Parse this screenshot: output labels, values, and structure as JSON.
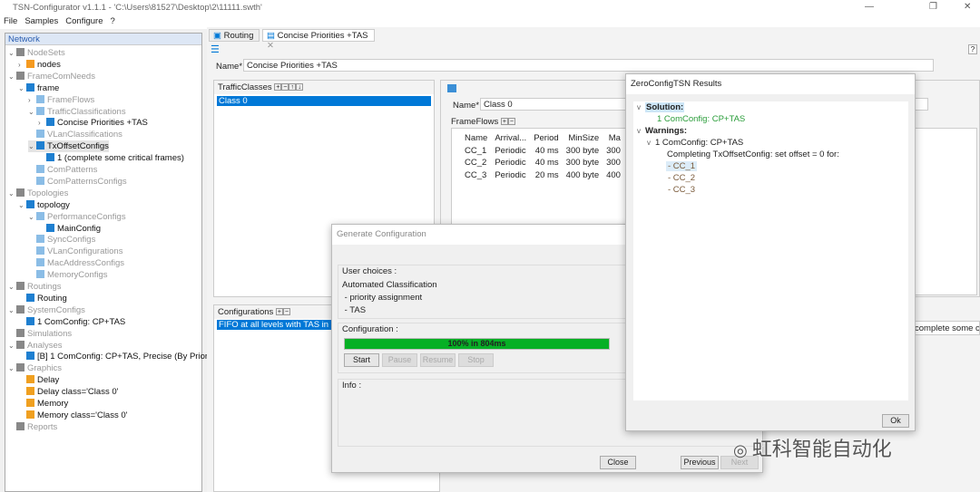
{
  "window": {
    "title": "TSN-Configurator v1.1.1 - 'C:\\Users\\81527\\Desktop\\2\\11111.swth'",
    "min": "—",
    "max": "❐",
    "close": "✕"
  },
  "menu": [
    "File",
    "Samples",
    "Configure",
    "?"
  ],
  "tree": {
    "header": "Network",
    "items": [
      {
        "label": "NodeSets",
        "arrow": "v",
        "level": 0,
        "style": "gray"
      },
      {
        "label": "nodes",
        "arrow": ">",
        "level": 1,
        "style": "dark"
      },
      {
        "label": "FrameComNeeds",
        "arrow": "v",
        "level": 0,
        "style": "gray"
      },
      {
        "label": "frame",
        "arrow": "v",
        "level": 1,
        "style": "dark"
      },
      {
        "label": "FrameFlows",
        "arrow": ">",
        "level": 2,
        "style": "gray"
      },
      {
        "label": "TrafficClassifications",
        "arrow": "v",
        "level": 2,
        "style": "gray"
      },
      {
        "label": "Concise Priorities +TAS",
        "arrow": ">",
        "level": 3,
        "style": "dark"
      },
      {
        "label": "VLanClassifications",
        "arrow": "",
        "level": 2,
        "style": "gray"
      },
      {
        "label": "TxOffsetConfigs",
        "arrow": "v",
        "level": 2,
        "style": "dark"
      },
      {
        "label": "1 (complete some critical frames)",
        "arrow": "",
        "level": 3,
        "style": "dark"
      },
      {
        "label": "ComPatterns",
        "arrow": "",
        "level": 2,
        "style": "gray"
      },
      {
        "label": "ComPatternsConfigs",
        "arrow": "",
        "level": 2,
        "style": "gray"
      },
      {
        "label": "Topologies",
        "arrow": "v",
        "level": 0,
        "style": "gray"
      },
      {
        "label": "topology",
        "arrow": "v",
        "level": 1,
        "style": "dark"
      },
      {
        "label": "PerformanceConfigs",
        "arrow": "v",
        "level": 2,
        "style": "gray"
      },
      {
        "label": "MainConfig",
        "arrow": "",
        "level": 3,
        "style": "dark"
      },
      {
        "label": "SyncConfigs",
        "arrow": "",
        "level": 2,
        "style": "gray"
      },
      {
        "label": "VLanConfigurations",
        "arrow": "",
        "level": 2,
        "style": "gray"
      },
      {
        "label": "MacAddressConfigs",
        "arrow": "",
        "level": 2,
        "style": "gray"
      },
      {
        "label": "MemoryConfigs",
        "arrow": "",
        "level": 2,
        "style": "gray"
      },
      {
        "label": "Routings",
        "arrow": "v",
        "level": 0,
        "style": "gray"
      },
      {
        "label": "Routing",
        "arrow": "",
        "level": 1,
        "style": "dark"
      },
      {
        "label": "SystemConfigs",
        "arrow": "v",
        "level": 0,
        "style": "gray"
      },
      {
        "label": "1 ComConfig: CP+TAS",
        "arrow": "",
        "level": 1,
        "style": "dark"
      },
      {
        "label": "Simulations",
        "arrow": "",
        "level": 0,
        "style": "gray"
      },
      {
        "label": "Analyses",
        "arrow": "v",
        "level": 0,
        "style": "gray"
      },
      {
        "label": "[B]  1 ComConfig: CP+TAS, Precise (By Priority)",
        "arrow": "",
        "level": 1,
        "style": "dark"
      },
      {
        "label": "Graphics",
        "arrow": "v",
        "level": 0,
        "style": "gray"
      },
      {
        "label": "Delay",
        "arrow": "",
        "level": 1,
        "style": "dark"
      },
      {
        "label": "Delay class='Class 0'",
        "arrow": "",
        "level": 1,
        "style": "dark"
      },
      {
        "label": "Memory",
        "arrow": "",
        "level": 1,
        "style": "dark"
      },
      {
        "label": "Memory class='Class 0'",
        "arrow": "",
        "level": 1,
        "style": "dark"
      },
      {
        "label": "Reports",
        "arrow": "",
        "level": 0,
        "style": "gray"
      }
    ]
  },
  "tabs": [
    {
      "label": "Routing"
    },
    {
      "label": "Concise Priorities +TAS"
    }
  ],
  "editor": {
    "name_label": "Name*",
    "name_value": "Concise Priorities +TAS",
    "traffic_classes": {
      "label": "TrafficClasses",
      "items": [
        "Class 0"
      ]
    },
    "class_name_label": "Name*",
    "class_name_value": "Class 0",
    "frameflows": {
      "label": "FrameFlows",
      "columns": [
        "Name",
        "Arrival...",
        "Period",
        "MinSize",
        "Ma"
      ],
      "rows": [
        [
          "CC_1",
          "Periodic",
          "40 ms",
          "300 byte",
          "300"
        ],
        [
          "CC_2",
          "Periodic",
          "40 ms",
          "300 byte",
          "300"
        ],
        [
          "CC_3",
          "Periodic",
          "20 ms",
          "400 byte",
          "400"
        ]
      ]
    },
    "configurations": {
      "label": "Configurations",
      "items": [
        "FIFO at all levels with TAS in Class 0"
      ]
    },
    "right_text": "complete some c"
  },
  "generate_dialog": {
    "title": "Generate Configuration",
    "user_choices_label": "User choices :",
    "choices": [
      "Automated Classification",
      " - priority assignment",
      " - TAS"
    ],
    "configuration_label": "Configuration :",
    "progress": 1.0,
    "progress_text": "100% in 804ms",
    "buttons": {
      "start": "Start",
      "pause": "Pause",
      "resume": "Resume",
      "stop": "Stop",
      "close": "Close",
      "previous": "Previous",
      "next": "Next"
    },
    "info_label": "Info :"
  },
  "results_dialog": {
    "title": "ZeroConfigTSN Results",
    "solution_label": "Solution:",
    "solution": "1 ComConfig: CP+TAS",
    "warnings_label": "Warnings:",
    "warning_item": "1 ComConfig: CP+TAS",
    "warning_text": "Completing TxOffsetConfig: set offset = 0 for:",
    "frames": [
      "- CC_1",
      "- CC_2",
      "- CC_3"
    ],
    "ok": "Ok"
  },
  "watermark": "虹科智能自动化",
  "colors": {
    "accent": "#0078d7",
    "progress": "#06b025",
    "solution": "#2a9d3a",
    "warning_frames": "#7a5a3a"
  }
}
